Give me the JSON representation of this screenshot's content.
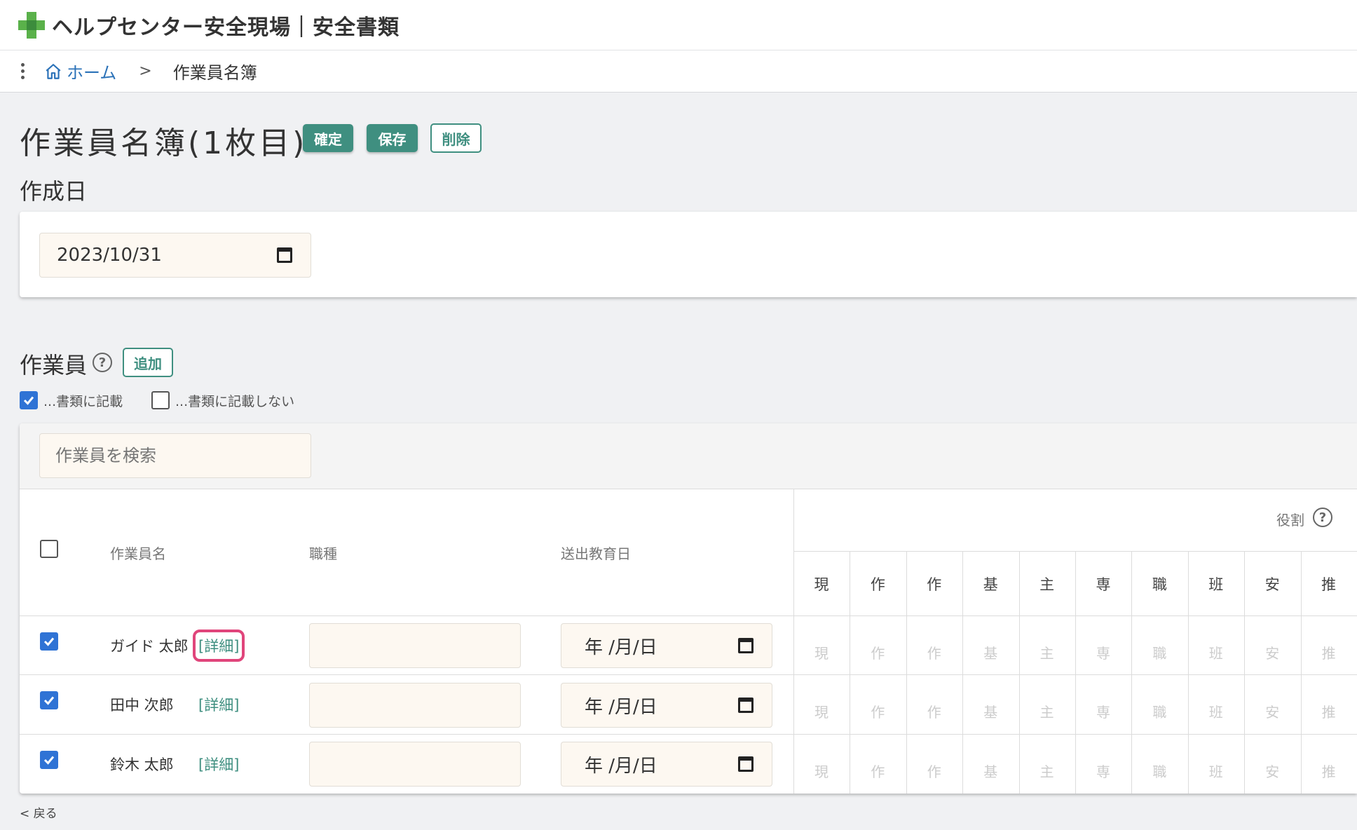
{
  "app": {
    "title": "ヘルプセンター安全現場｜安全書類"
  },
  "breadcrumb": {
    "home": "ホーム",
    "separator": ">",
    "current": "作業員名簿"
  },
  "page": {
    "title": "作業員名簿(1枚目)",
    "confirm_label": "確定",
    "save_label": "保存",
    "delete_label": "削除"
  },
  "creation_date": {
    "label": "作成日",
    "value": "2023/10/31"
  },
  "workers": {
    "label": "作業員",
    "help": "?",
    "add_label": "追加",
    "legend_checked": "...書類に記載",
    "legend_unchecked": "...書類に記載しない",
    "search_placeholder": "作業員を検索",
    "columns": {
      "name": "作業員名",
      "job": "職種",
      "education_date": "送出教育日",
      "roles": "役割"
    },
    "role_headers": [
      "現",
      "作",
      "作",
      "基",
      "主",
      "専",
      "職",
      "班",
      "安",
      "推"
    ],
    "rows": [
      {
        "name": "ガイド 太郎",
        "detail": "[詳細]",
        "job": "",
        "date": "年 /月/日",
        "checked": true
      },
      {
        "name": "田中 次郎",
        "detail": "[詳細]",
        "job": "",
        "date": "年 /月/日",
        "checked": true
      },
      {
        "name": "鈴木 太郎",
        "detail": "[詳細]",
        "job": "",
        "date": "年 /月/日",
        "checked": true
      }
    ]
  },
  "footer": {
    "back": "< 戻る"
  },
  "colors": {
    "accent": "#3f8f80",
    "checkbox": "#2f73d5",
    "highlight": "#e0457b",
    "input_bg": "#fdf8f1"
  },
  "icons": [
    "plus-logo-icon",
    "kebab-menu-icon",
    "home-icon",
    "calendar-icon",
    "help-icon",
    "checkbox-icon"
  ]
}
